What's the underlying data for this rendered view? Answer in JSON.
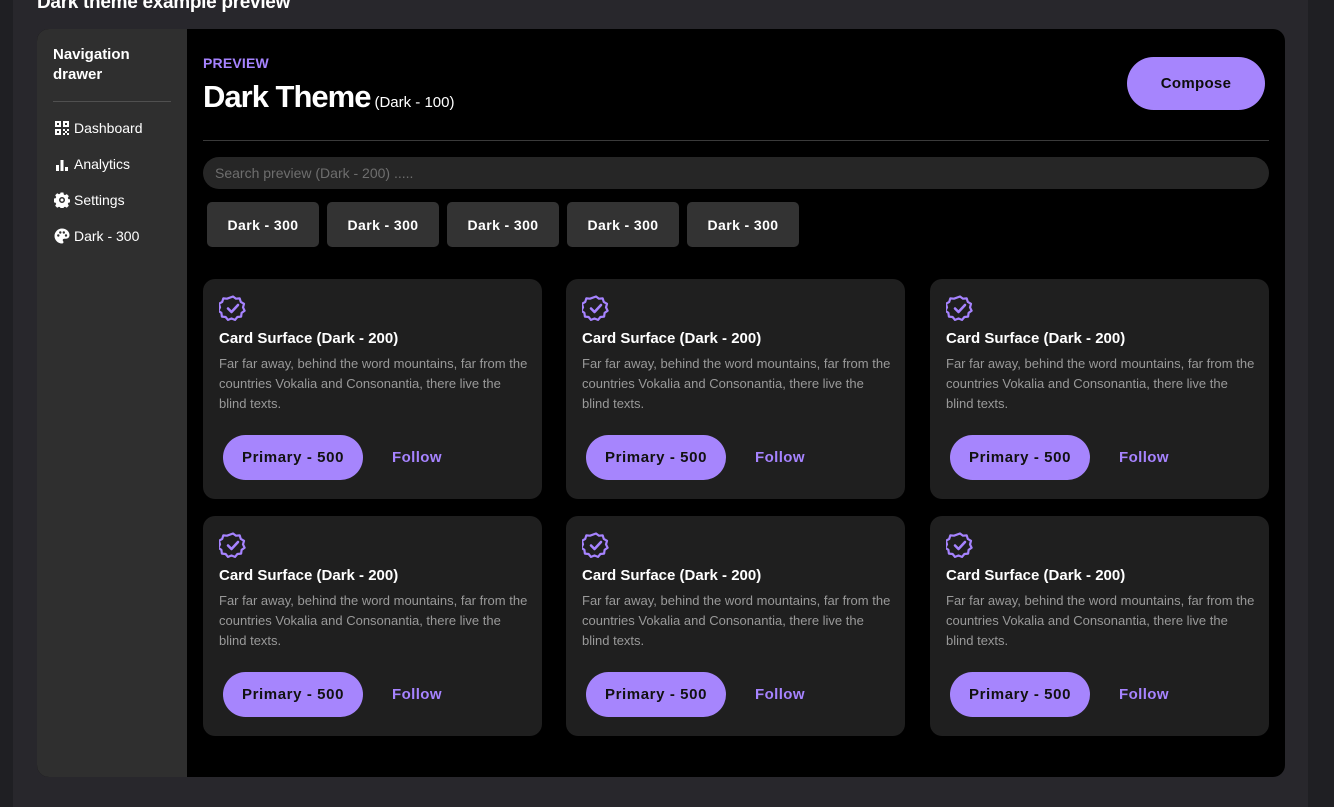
{
  "page_heading": "Dark theme example preview",
  "drawer": {
    "title": "Navigation drawer",
    "items": [
      {
        "label": "Dashboard",
        "icon": "dashboard-icon"
      },
      {
        "label": "Analytics",
        "icon": "bar-chart-icon"
      },
      {
        "label": "Settings",
        "icon": "gear-icon"
      },
      {
        "label": "Dark - 300",
        "icon": "palette-icon"
      }
    ]
  },
  "header": {
    "preview_label": "PREVIEW",
    "title": "Dark Theme",
    "title_sub": "(Dark - 100)",
    "compose_label": "Compose"
  },
  "search": {
    "placeholder": "Search preview (Dark - 200) .....",
    "value": ""
  },
  "chips": [
    "Dark - 300",
    "Dark - 300",
    "Dark - 300",
    "Dark - 300",
    "Dark - 300"
  ],
  "cards": [
    {
      "title": "Card Surface (Dark - 200)",
      "body": "Far far away, behind the word mountains, far from the countries Vokalia and Consonantia, there live the blind texts.",
      "primary_label": "Primary - 500",
      "follow_label": "Follow",
      "icon": "verified-badge-icon"
    },
    {
      "title": "Card Surface (Dark - 200)",
      "body": "Far far away, behind the word mountains, far from the countries Vokalia and Consonantia, there live the blind texts.",
      "primary_label": "Primary - 500",
      "follow_label": "Follow",
      "icon": "verified-badge-icon"
    },
    {
      "title": "Card Surface (Dark - 200)",
      "body": "Far far away, behind the word mountains, far from the countries Vokalia and Consonantia, there live the blind texts.",
      "primary_label": "Primary - 500",
      "follow_label": "Follow",
      "icon": "verified-badge-icon"
    },
    {
      "title": "Card Surface (Dark - 200)",
      "body": "Far far away, behind the word mountains, far from the countries Vokalia and Consonantia, there live the blind texts.",
      "primary_label": "Primary - 500",
      "follow_label": "Follow",
      "icon": "verified-badge-icon"
    },
    {
      "title": "Card Surface (Dark - 200)",
      "body": "Far far away, behind the word mountains, far from the countries Vokalia and Consonantia, there live the blind texts.",
      "primary_label": "Primary - 500",
      "follow_label": "Follow",
      "icon": "verified-badge-icon"
    },
    {
      "title": "Card Surface (Dark - 200)",
      "body": "Far far away, behind the word mountains, far from the countries Vokalia and Consonantia, there live the blind texts.",
      "primary_label": "Primary - 500",
      "follow_label": "Follow",
      "icon": "verified-badge-icon"
    }
  ],
  "colors": {
    "primary": "#a685fd",
    "background": "#000000",
    "surface": "#1f1f1f",
    "drawer": "#2f2f2f",
    "chip": "#333333"
  }
}
